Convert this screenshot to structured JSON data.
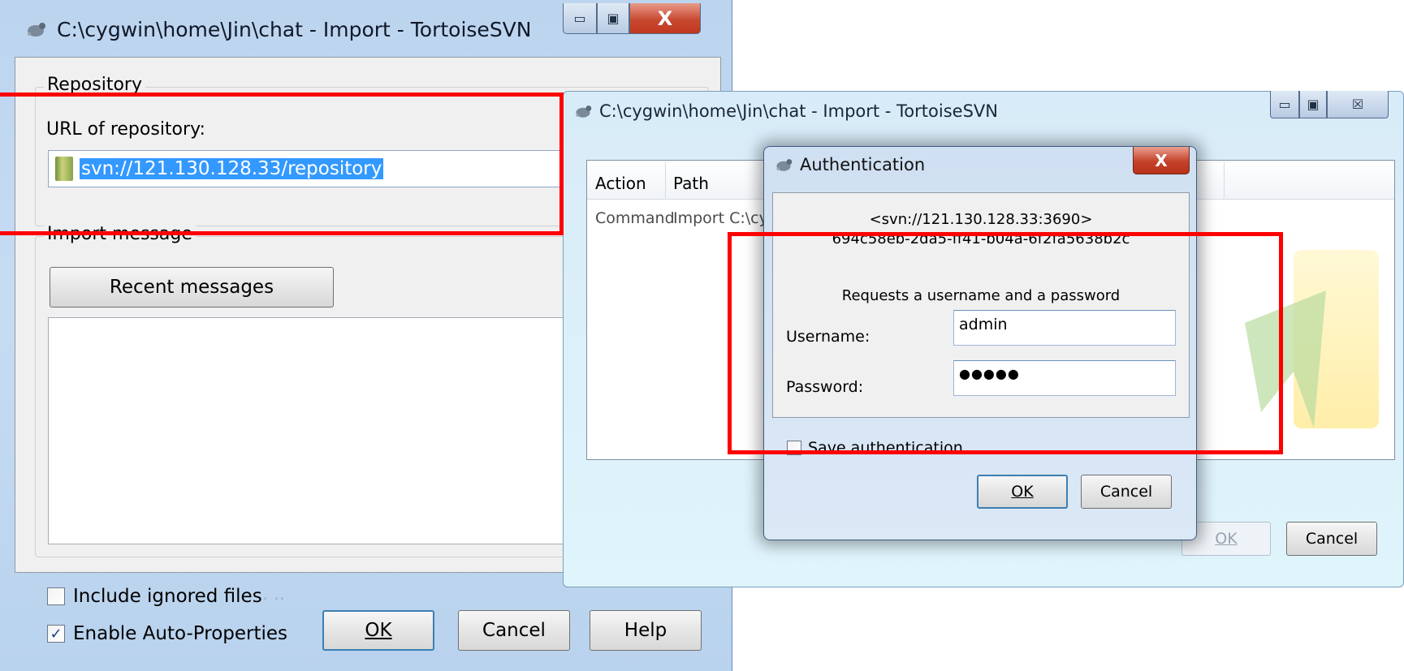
{
  "import_dialog": {
    "title": "C:\\cygwin\\home\\Jin\\chat - Import - TortoiseSVN",
    "repository_group": "Repository",
    "url_label": "URL of repository:",
    "url_value": "svn://121.130.128.33/repository",
    "message_group": "Import message",
    "recent_messages": "Recent messages",
    "include_ignored": "Include ignored files",
    "include_ignored_checked": false,
    "auto_props": "Enable Auto-Properties",
    "auto_props_checked": true,
    "ok": "OK",
    "cancel": "Cancel",
    "help": "Help",
    "minimize_glyph": "▭",
    "maximize_glyph": "▣",
    "close_glyph": "X"
  },
  "progress_dialog": {
    "title": "C:\\cygwin\\home\\Jin\\chat - Import - TortoiseSVN",
    "columns": [
      "Action",
      "Path"
    ],
    "row": {
      "action": "Command",
      "path": "Import C:\\cyg"
    },
    "ok": "OK",
    "cancel": "Cancel",
    "minimize_glyph": "▭",
    "maximize_glyph": "▣",
    "close_glyph": "☒"
  },
  "auth_dialog": {
    "title": "Authentication",
    "realm_line1": "<svn://121.130.128.33:3690>",
    "realm_line2": "694c58eb-2da5-ff41-b04a-6f2fa5638b2c",
    "request_text": "Requests a username and a password",
    "username_label": "Username:",
    "username_value": "admin",
    "password_label": "Password:",
    "password_value": "●●●●●",
    "save_auth": "Save authentication",
    "save_auth_checked": false,
    "ok": "OK",
    "cancel": "Cancel",
    "close_glyph": "X"
  },
  "colors": {
    "highlight_box": "#ff0000",
    "selection": "#3399ff"
  }
}
